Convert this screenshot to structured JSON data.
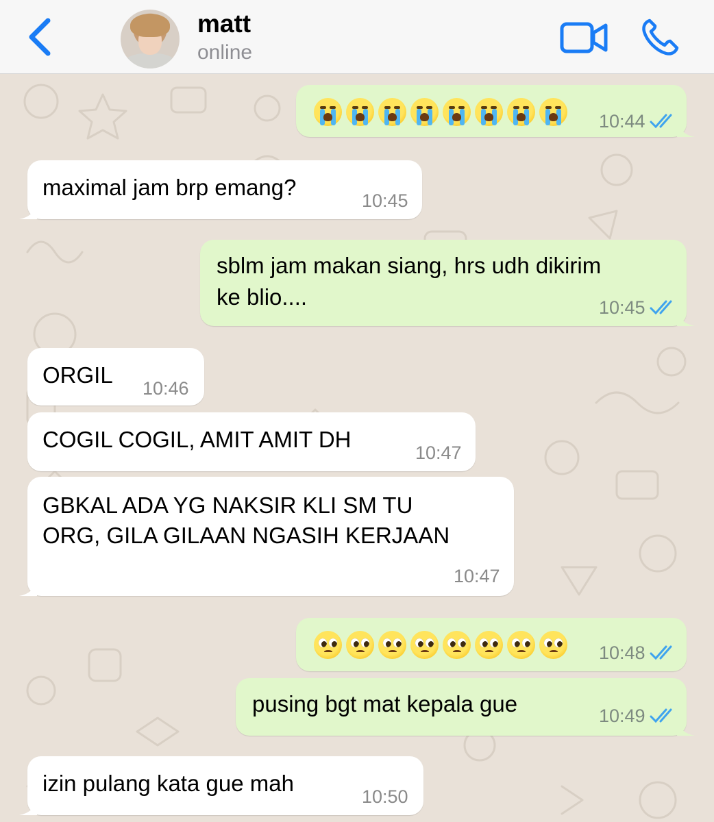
{
  "header": {
    "contact_name": "matt",
    "contact_status": "online",
    "accent_color": "#1a7cf5"
  },
  "icons": {
    "back": "chevron-left-icon",
    "video": "video-camera-icon",
    "call": "phone-icon",
    "read": "double-check-icon"
  },
  "messages": [
    {
      "dir": "out",
      "text": "😭😭😭😭😭😭😭😭",
      "time": "10:44",
      "read": true
    },
    {
      "dir": "in",
      "text": "maximal jam brp emang?",
      "time": "10:45"
    },
    {
      "dir": "out",
      "text": "sblm jam makan siang, hrs udh dikirim ke blio....",
      "time": "10:45",
      "read": true
    },
    {
      "dir": "in",
      "text": "ORGIL",
      "time": "10:46"
    },
    {
      "dir": "in",
      "text": "COGIL COGIL, AMIT AMIT DH",
      "time": "10:47"
    },
    {
      "dir": "in",
      "text": "GBKAL ADA YG NAKSIR KLI SM TU ORG, GILA GILAAN NGASIH KERJAAN",
      "time": "10:47"
    },
    {
      "dir": "out",
      "text": "🥺🥺🥺🥺🥺🥺🥺🥺",
      "time": "10:48",
      "read": true
    },
    {
      "dir": "out",
      "text": "pusing bgt mat kepala gue",
      "time": "10:49",
      "read": true
    },
    {
      "dir": "in",
      "text": "izin pulang kata gue mah",
      "time": "10:50"
    }
  ],
  "display": {
    "m2_line1": "sblm jam makan siang, hrs udh dikirim",
    "m2_line2": "ke blio....",
    "m5_line1": "GBKAL ADA YG NAKSIR KLI SM TU",
    "m5_line2": "ORG, GILA GILAAN NGASIH KERJAAN"
  },
  "colors": {
    "outgoing_bubble": "#e1f7cb",
    "incoming_bubble": "#ffffff",
    "chat_background": "#e9e1d8",
    "read_ticks": "#3fa3ee"
  }
}
